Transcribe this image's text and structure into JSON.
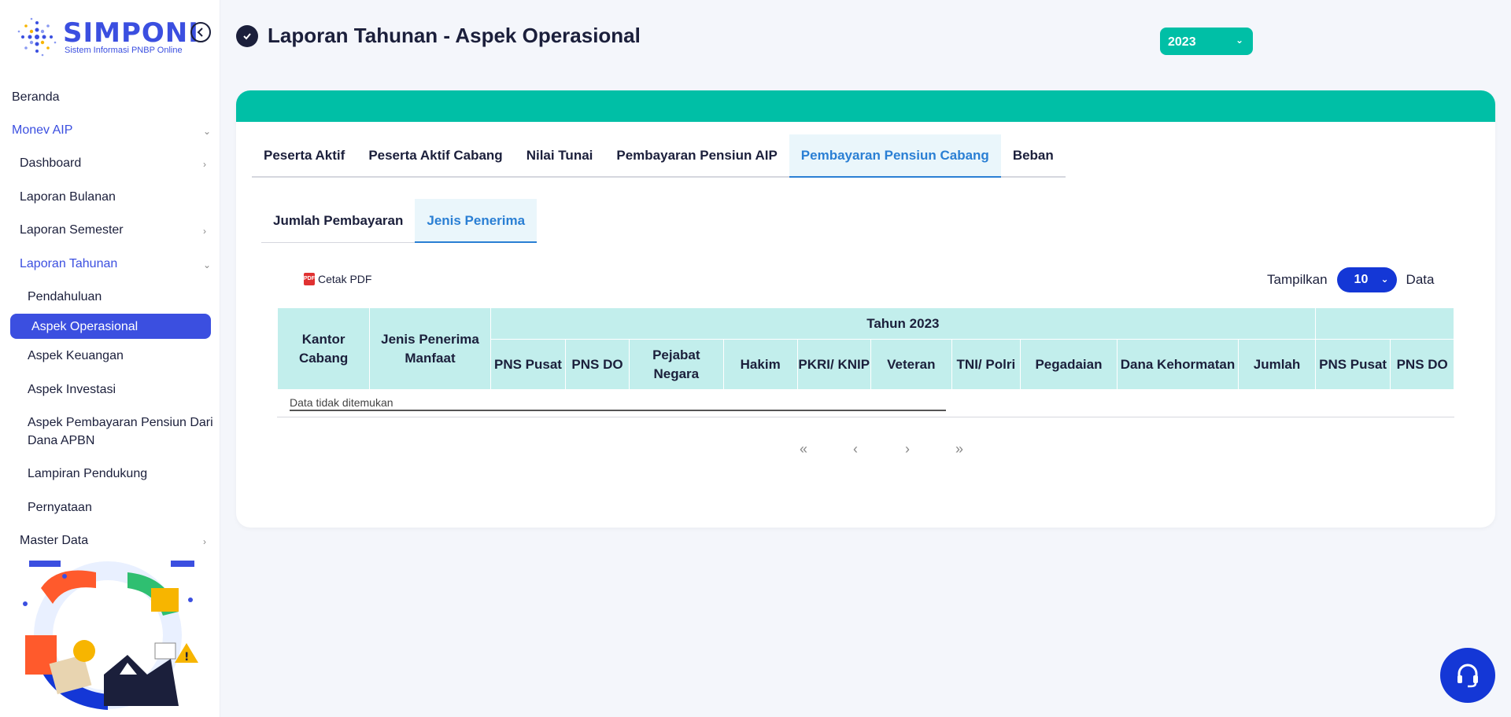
{
  "brand": {
    "title": "SIMPONI",
    "subtitle": "Sistem Informasi PNBP Online"
  },
  "sidebar": {
    "items": [
      {
        "label": "Beranda"
      },
      {
        "label": "Monev AIP"
      },
      {
        "label": "Dashboard"
      },
      {
        "label": "Laporan Bulanan"
      },
      {
        "label": "Laporan Semester"
      },
      {
        "label": "Laporan Tahunan"
      },
      {
        "label": "Pendahuluan"
      },
      {
        "label": "Aspek Operasional"
      },
      {
        "label": "Aspek Keuangan"
      },
      {
        "label": "Aspek Investasi"
      },
      {
        "label": "Aspek Pembayaran Pensiun Dari"
      },
      {
        "label": "Dana APBN"
      },
      {
        "label": "Lampiran Pendukung"
      },
      {
        "label": "Pernyataan"
      },
      {
        "label": "Master Data"
      }
    ]
  },
  "header": {
    "title": "Laporan Tahunan - Aspek Operasional",
    "year": "2023"
  },
  "tabs": [
    "Peserta Aktif",
    "Peserta Aktif Cabang",
    "Nilai Tunai",
    "Pembayaran Pensiun AIP",
    "Pembayaran Pensiun Cabang",
    "Beban"
  ],
  "subtabs": [
    "Jumlah Pembayaran",
    "Jenis Penerima"
  ],
  "toolbar": {
    "pdf_label": "Cetak PDF",
    "show_label": "Tampilkan",
    "show_value": "10",
    "data_label": "Data"
  },
  "table": {
    "headers": {
      "kantor_cabang": "Kantor Cabang",
      "jenis_penerima": "Jenis Penerima Manfaat",
      "group": "Tahun 2023",
      "cols": [
        "PNS Pusat",
        "PNS DO",
        "Pejabat Negara",
        "Hakim",
        "PKRI/ KNIP",
        "Veteran",
        "TNI/ Polri",
        "Pegadaian",
        "Dana Kehormatan",
        "Jumlah",
        "PNS Pusat",
        "PNS DO"
      ]
    },
    "empty_message": "Data tidak ditemukan"
  },
  "pager": {
    "first": "«",
    "prev": "‹",
    "next": "›",
    "last": "»"
  },
  "colors": {
    "primary": "#3b4fe0",
    "teal": "#00bfa6",
    "header_bg": "#c2eeec",
    "tab_active": "#2a7fd4"
  }
}
